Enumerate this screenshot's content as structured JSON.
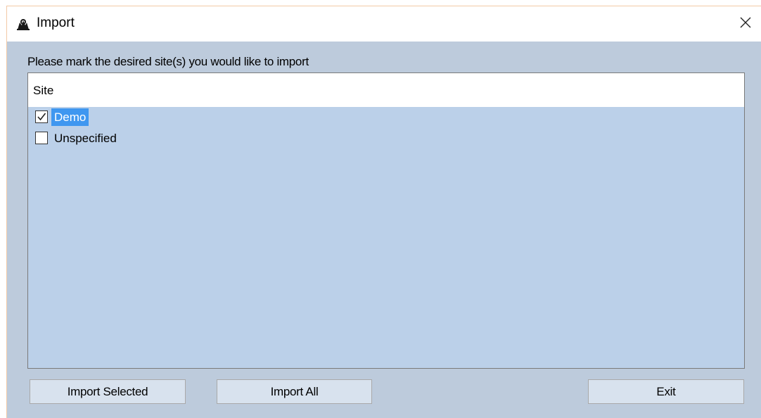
{
  "window": {
    "title": "Import",
    "app_icon": "app-logo-icon",
    "close_icon": "close-icon"
  },
  "prompt": "Please mark the desired site(s) you would like to import",
  "list": {
    "column_header": "Site",
    "items": [
      {
        "label": "Demo",
        "checked": true,
        "selected": true
      },
      {
        "label": "Unspecified",
        "checked": false,
        "selected": false
      }
    ]
  },
  "buttons": {
    "import_selected": "Import Selected",
    "import_all": "Import All",
    "exit": "Exit"
  },
  "colors": {
    "dialog_bg": "#bdcbdc",
    "list_bg": "#bbd0e9",
    "selection": "#3f97f0",
    "button_bg": "#d8e2ee"
  }
}
